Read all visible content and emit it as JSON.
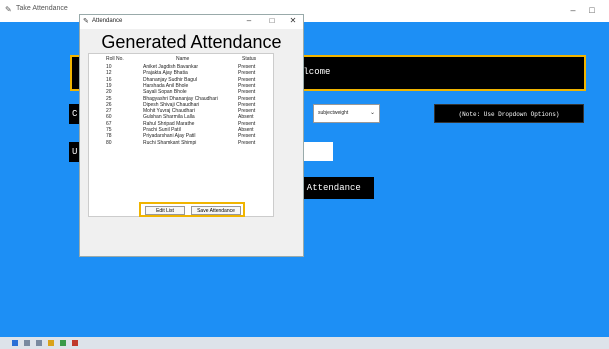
{
  "main_window": {
    "title": "Take Attendance",
    "welcome_text": "elcome",
    "left_label_1": "C",
    "left_label_2": "U",
    "dropdown_value": "subjectweight",
    "note_text": "(Note: Use Dropdown Options)",
    "take_attendance_label": "n Attendance",
    "minimize": "–",
    "maximize": "□"
  },
  "dialog": {
    "title": "Attendance",
    "heading": "Generated Attendance",
    "minimize": "–",
    "maximize": "□",
    "close": "✕",
    "columns": {
      "roll": "Roll No.",
      "name": "Name",
      "status": "Status"
    },
    "rows": [
      {
        "roll": "10",
        "name": "Aniket Jagdish Bavankar",
        "status": "Present"
      },
      {
        "roll": "12",
        "name": "Prajakta Ajay Bhatia",
        "status": "Present"
      },
      {
        "roll": "16",
        "name": "Dhananjay Sudhir Bagul",
        "status": "Present"
      },
      {
        "roll": "19",
        "name": "Harshada Anil Bhole",
        "status": "Present"
      },
      {
        "roll": "20",
        "name": "Sayali Sopan Bhole",
        "status": "Present"
      },
      {
        "roll": "25",
        "name": "Bhagyashri Dhananjay Chaudhari",
        "status": "Present"
      },
      {
        "roll": "26",
        "name": "Dipesh Shivaji Chaudhari",
        "status": "Present"
      },
      {
        "roll": "27",
        "name": "Mohit Yuvraj Chaudhari",
        "status": "Present"
      },
      {
        "roll": "60",
        "name": "Gulshan Sharmila Lalla",
        "status": "Absent"
      },
      {
        "roll": "67",
        "name": "Rahul Shripad Marathe",
        "status": "Present"
      },
      {
        "roll": "75",
        "name": "Prachi Sunil Patil",
        "status": "Absent"
      },
      {
        "roll": "78",
        "name": "Priyadarshani Ajay Patil",
        "status": "Present"
      },
      {
        "roll": "80",
        "name": "Ruchi Shamkant Shimpi",
        "status": "Present"
      }
    ],
    "edit_button": "Edit List",
    "save_button": "Save Attendance"
  },
  "colors": {
    "background": "#1e90ff",
    "accent_border": "#f0b400"
  }
}
